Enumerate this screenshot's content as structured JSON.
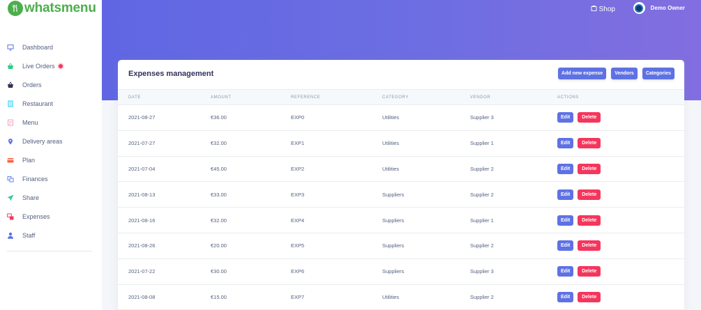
{
  "brand": {
    "name": "whatsmenu"
  },
  "sidebar": {
    "items": [
      {
        "label": "Dashboard",
        "icon": "monitor-icon",
        "color": "#5e72e4"
      },
      {
        "label": "Live Orders",
        "icon": "basket-icon",
        "color": "#2dce89"
      },
      {
        "label": "Orders",
        "icon": "basket-icon",
        "color": "#32325d"
      },
      {
        "label": "Restaurant",
        "icon": "building-icon",
        "color": "#11cdef"
      },
      {
        "label": "Menu",
        "icon": "menu-icon",
        "color": "#f3a4b5"
      },
      {
        "label": "Delivery areas",
        "icon": "pin-icon",
        "color": "#5e72e4"
      },
      {
        "label": "Plan",
        "icon": "card-icon",
        "color": "#fb6340"
      },
      {
        "label": "Finances",
        "icon": "wallet-icon",
        "color": "#5e72e4"
      },
      {
        "label": "Share",
        "icon": "send-icon",
        "color": "#2dce89"
      },
      {
        "label": "Expenses",
        "icon": "expenses-icon",
        "color": "#f5365c"
      },
      {
        "label": "Staff",
        "icon": "user-icon",
        "color": "#5e72e4"
      }
    ]
  },
  "header": {
    "shop_label": "Shop",
    "user_name": "Demo Owner"
  },
  "card": {
    "title": "Expenses management",
    "buttons": {
      "add": "Add new expense",
      "vendors": "Vendors",
      "categories": "Categories"
    }
  },
  "table": {
    "columns": [
      "Date",
      "Amount",
      "Reference",
      "Category",
      "Vendor",
      "Actions"
    ],
    "rows": [
      {
        "date": "2021-08-27",
        "amount": "€36.00",
        "reference": "EXP0",
        "category": "Utilities",
        "vendor": "Supplier 3"
      },
      {
        "date": "2021-07-27",
        "amount": "€32.00",
        "reference": "EXP1",
        "category": "Utilities",
        "vendor": "Supplier 1"
      },
      {
        "date": "2021-07-04",
        "amount": "€45.00",
        "reference": "EXP2",
        "category": "Utilities",
        "vendor": "Supplier 2"
      },
      {
        "date": "2021-08-13",
        "amount": "€33.00",
        "reference": "EXP3",
        "category": "Suppliers",
        "vendor": "Supplier 2"
      },
      {
        "date": "2021-08-16",
        "amount": "€32.00",
        "reference": "EXP4",
        "category": "Suppliers",
        "vendor": "Supplier 1"
      },
      {
        "date": "2021-08-26",
        "amount": "€20.00",
        "reference": "EXP5",
        "category": "Suppliers",
        "vendor": "Supplier 2"
      },
      {
        "date": "2021-07-22",
        "amount": "€30.00",
        "reference": "EXP6",
        "category": "Suppliers",
        "vendor": "Supplier 3"
      },
      {
        "date": "2021-08-08",
        "amount": "€15.00",
        "reference": "EXP7",
        "category": "Utilities",
        "vendor": "Supplier 2"
      }
    ],
    "edit_label": "Edit",
    "delete_label": "Delete"
  }
}
